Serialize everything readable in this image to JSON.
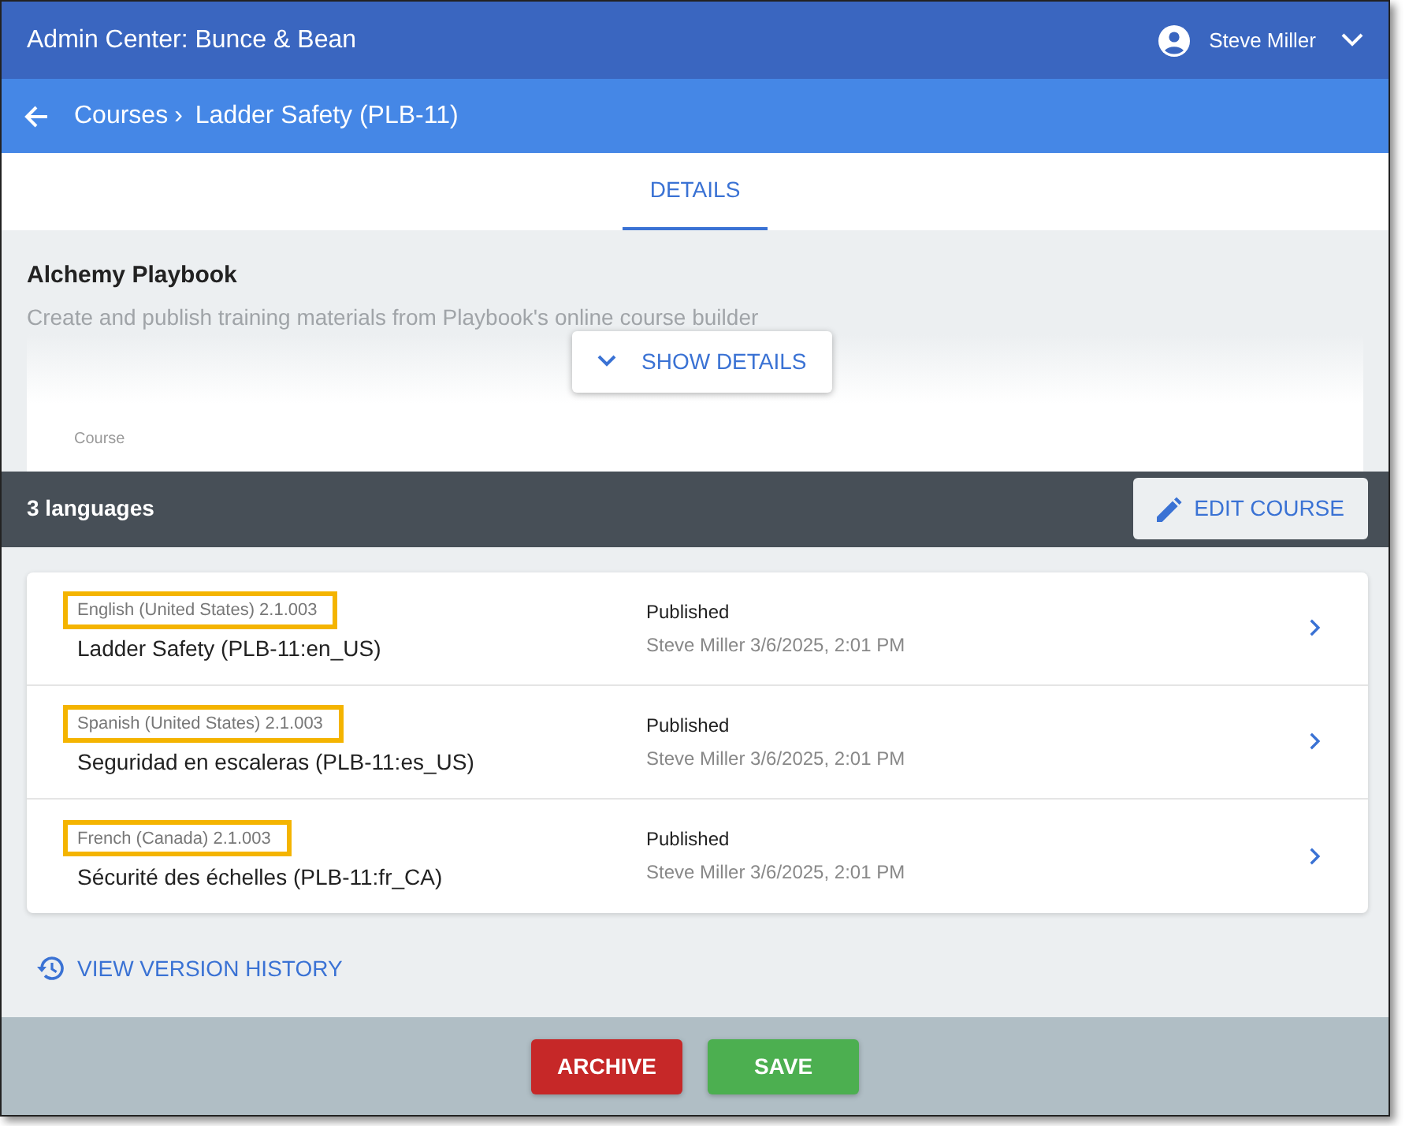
{
  "header": {
    "title": "Admin Center: Bunce & Bean",
    "user": "Steve Miller"
  },
  "breadcrumb": {
    "parent": "Courses",
    "separator": "›",
    "current": "Ladder Safety (PLB-11)"
  },
  "tabs": [
    {
      "label": "DETAILS",
      "selected": true
    }
  ],
  "course": {
    "title": "Alchemy Playbook",
    "description": "Create and publish training materials from Playbook's online course builder",
    "show_details": "SHOW DETAILS",
    "field_label": "Course"
  },
  "languages_bar": {
    "count": "3 languages",
    "edit_button": "EDIT COURSE"
  },
  "versions": [
    {
      "language": "English (United States) 2.1.003",
      "highlighted": true,
      "name": "Ladder Safety (PLB-11:en_US)",
      "status": "Published",
      "meta": "Steve Miller 3/6/2025, 2:01 PM"
    },
    {
      "language": "Spanish (United States) 2.1.003",
      "highlighted": true,
      "name": "Seguridad en escaleras (PLB-11:es_US)",
      "status": "Published",
      "meta": "Steve Miller 3/6/2025, 2:01 PM"
    },
    {
      "language": "French (Canada) 2.1.003",
      "highlighted": true,
      "name": "Sécurité des échelles (PLB-11:fr_CA)",
      "status": "Published",
      "meta": "Steve Miller 3/6/2025, 2:01 PM"
    }
  ],
  "history_link": "VIEW VERSION HISTORY",
  "footer_buttons": [
    {
      "label": "ARCHIVE",
      "kind": "danger"
    },
    {
      "label": "SAVE",
      "kind": "success"
    }
  ]
}
